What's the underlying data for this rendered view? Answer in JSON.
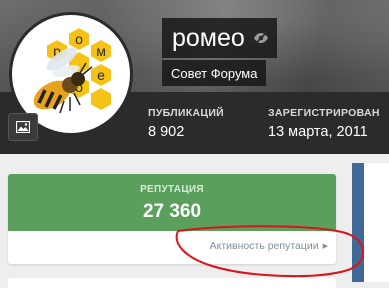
{
  "profile": {
    "username": "ромео",
    "group": "Совет Форума",
    "avatar_letters": [
      "р",
      "о",
      "м",
      "е",
      "о"
    ]
  },
  "stats": [
    {
      "label": "ПУБЛИКАЦИЙ",
      "value": "8 902"
    },
    {
      "label": "ЗАРЕГИСТРИРОВАН",
      "value": "13 марта, 2011"
    }
  ],
  "reputation": {
    "label": "РЕПУТАЦИЯ",
    "value": "27 360",
    "link_label": "Активность репутации"
  },
  "icons": {
    "cover_photo": "image-icon",
    "visibility": "eye-slash-icon",
    "link_arrow": "caret-right-icon"
  },
  "colors": {
    "reputation_green": "#5a9f5c",
    "annotation_red": "#d9151b"
  }
}
